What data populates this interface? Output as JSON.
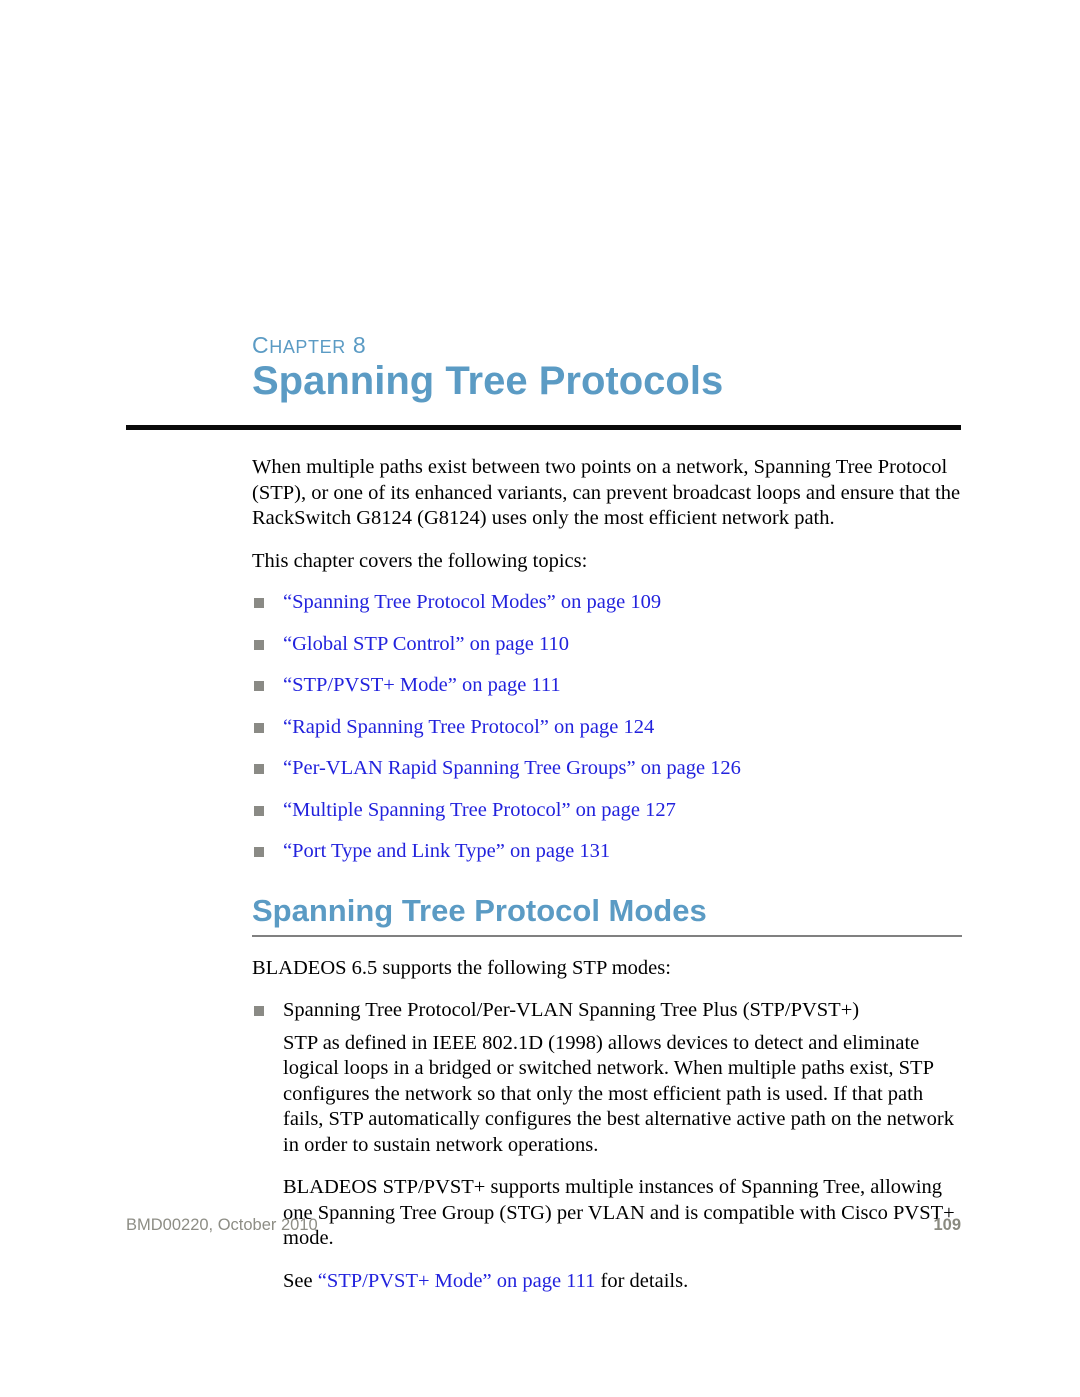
{
  "chapter": {
    "eyebrow_label": "CHAPTER",
    "eyebrow_first": "C",
    "eyebrow_rest": "HAPTER",
    "number": "8",
    "title": "Spanning Tree Protocols"
  },
  "intro": {
    "paragraph_1": "When multiple paths exist between two points on a network, Spanning Tree Protocol (STP), or one of its enhanced variants, can prevent broadcast loops and ensure that the RackSwitch G8124 (G8124) uses only the most efficient network path.",
    "paragraph_2": "This chapter covers the following topics:"
  },
  "topics": [
    {
      "text": "“Spanning Tree Protocol Modes” on page 109"
    },
    {
      "text": "“Global STP Control” on page 110"
    },
    {
      "text": "“STP/PVST+ Mode” on page 111"
    },
    {
      "text": "“Rapid Spanning Tree Protocol” on page 124"
    },
    {
      "text": "“Per-VLAN Rapid Spanning Tree Groups” on page 126"
    },
    {
      "text": "“Multiple Spanning Tree Protocol” on page 127"
    },
    {
      "text": "“Port Type and Link Type” on page 131"
    }
  ],
  "section": {
    "title": "Spanning Tree Protocol Modes",
    "intro": "BLADEOS 6.5 supports the following STP modes:",
    "mode_bullet": "Spanning Tree Protocol/Per-VLAN Spanning Tree Plus (STP/PVST+)",
    "paragraph_1": "STP as defined in IEEE 802.1D (1998) allows devices to detect and eliminate logical loops in a bridged or switched network. When multiple paths exist, STP configures the network so that only the most efficient path is used. If that path fails, STP automatically configures the best alternative active path on the network in order to sustain network operations.",
    "paragraph_2": "BLADEOS STP/PVST+ supports multiple instances of Spanning Tree, allowing one Spanning Tree Group (STG) per VLAN and is compatible with Cisco PVST+ mode.",
    "see_prefix": "See ",
    "see_link": "“STP/PVST+ Mode” on page 111",
    "see_suffix": " for details."
  },
  "footer": {
    "document_id": "BMD00220, October 2010",
    "page_number": "109"
  },
  "colors": {
    "heading_blue": "#5b9bc4",
    "link_blue": "#2222dd",
    "bullet_gray": "#8a8a85",
    "footer_gray": "#8d8d85",
    "chapter_rule": "#0a0a0a",
    "section_rule": "#808080"
  }
}
